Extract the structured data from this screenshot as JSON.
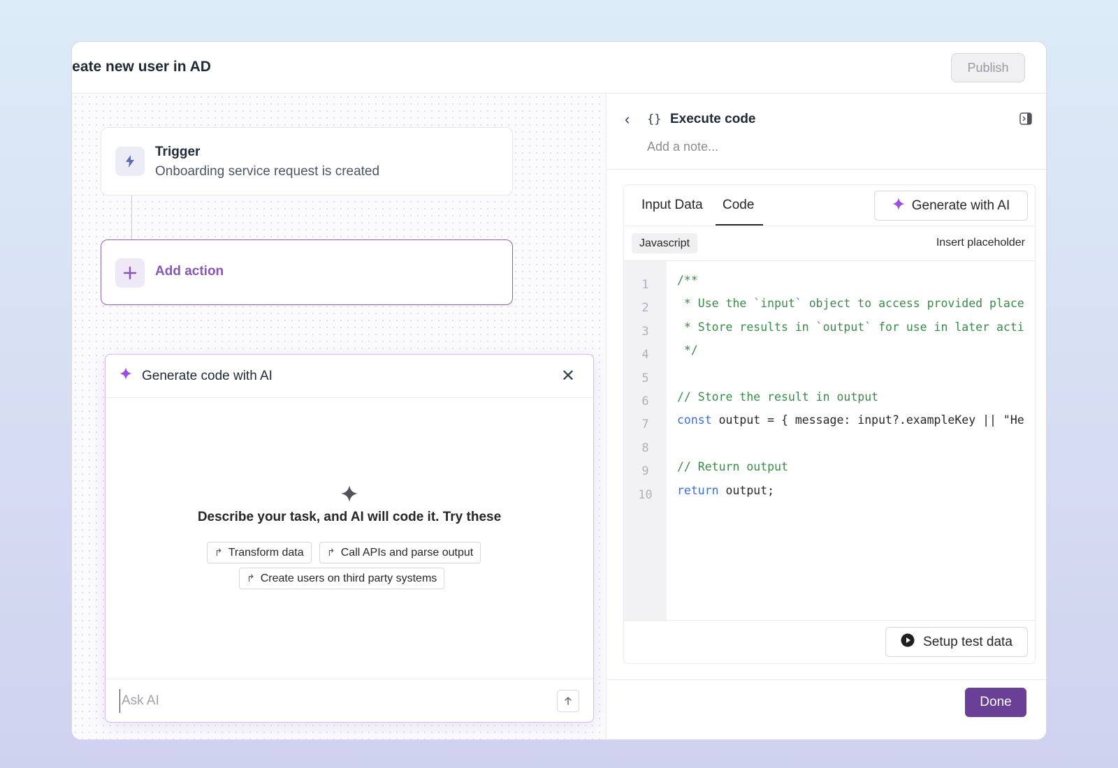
{
  "header": {
    "title": "reate new user in AD",
    "publish_label": "Publish"
  },
  "canvas": {
    "trigger": {
      "title": "Trigger",
      "subtitle": "Onboarding service request is created",
      "icon": "bolt-icon"
    },
    "add_action": {
      "label": "Add action",
      "icon": "plus-icon"
    }
  },
  "ai_panel": {
    "title": "Generate code with AI",
    "prompt": "Describe your task, and AI will code it. Try these",
    "suggestions": [
      "Transform data",
      "Call APIs and parse output",
      "Create users on third party systems"
    ],
    "input_placeholder": "Ask AI"
  },
  "right_panel": {
    "title": "Execute code",
    "braces": "{}",
    "note_placeholder": "Add a note...",
    "tabs": [
      "Input Data",
      "Code"
    ],
    "active_tab": "Code",
    "generate_label": "Generate with AI",
    "language": "Javascript",
    "insert_placeholder_label": "Insert placeholder",
    "code_lines": [
      {
        "num": "1",
        "text": "/**",
        "kind": "comment"
      },
      {
        "num": "2",
        "text": " * Use the `input` object to access provided place",
        "kind": "comment"
      },
      {
        "num": "3",
        "text": " * Store results in `output` for use in later acti",
        "kind": "comment"
      },
      {
        "num": "4",
        "text": " */",
        "kind": "comment"
      },
      {
        "num": "5",
        "text": "",
        "kind": "plain"
      },
      {
        "num": "6",
        "text": "// Store the result in output",
        "kind": "comment"
      },
      {
        "num": "7",
        "kw": "const",
        "text": " output = { message: input?.exampleKey || \"He",
        "kind": "kw"
      },
      {
        "num": "8",
        "text": "",
        "kind": "plain"
      },
      {
        "num": "9",
        "text": "// Return output",
        "kind": "comment"
      },
      {
        "num": "10",
        "kw": "return",
        "text": " output;",
        "kind": "kw"
      }
    ],
    "setup_label": "Setup test data",
    "done_label": "Done"
  },
  "colors": {
    "accent": "#6a3f96",
    "sparkle": "#9b4fe0",
    "comment": "#3a8a4a",
    "keyword": "#3b6fd1"
  }
}
